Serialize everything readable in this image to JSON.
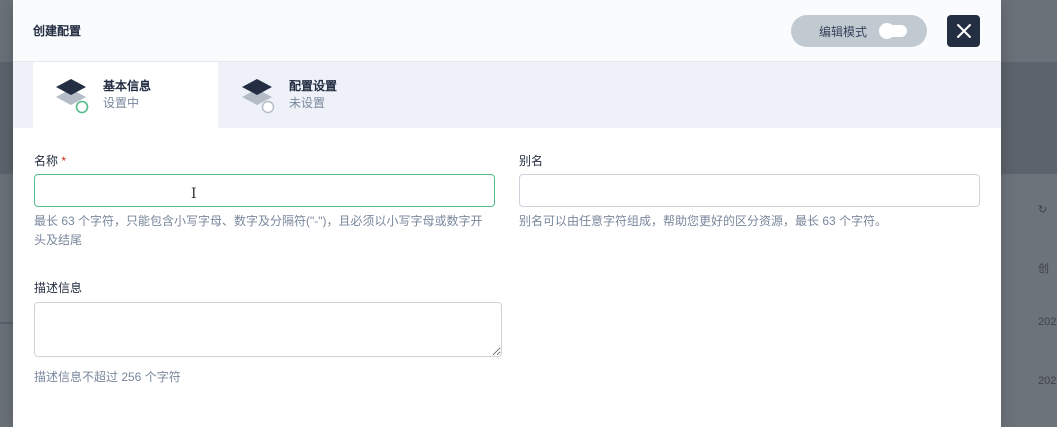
{
  "background": {
    "side_text": [
      "创",
      "202",
      "202"
    ]
  },
  "modal": {
    "title": "创建配置",
    "edit_mode_label": "编辑模式",
    "close_icon": "close-icon"
  },
  "steps": [
    {
      "title": "基本信息",
      "status": "设置中",
      "icon": "layers-icon"
    },
    {
      "title": "配置设置",
      "status": "未设置",
      "icon": "layers-icon"
    }
  ],
  "form": {
    "name": {
      "label": "名称",
      "required_mark": "*",
      "value": "",
      "placeholder": "",
      "hint": "最长 63 个字符，只能包含小写字母、数字及分隔符(\"-\")，且必须以小写字母或数字开头及结尾"
    },
    "alias": {
      "label": "别名",
      "value": "",
      "placeholder": "",
      "hint": "别名可以由任意字符组成，帮助您更好的区分资源，最长 63 个字符。"
    },
    "description": {
      "label": "描述信息",
      "value": "",
      "hint": "描述信息不超过 256 个字符"
    }
  },
  "colors": {
    "accent_green": "#55bc8a",
    "dark": "#242e42",
    "required": "#ca2621",
    "hint": "#79879c"
  }
}
